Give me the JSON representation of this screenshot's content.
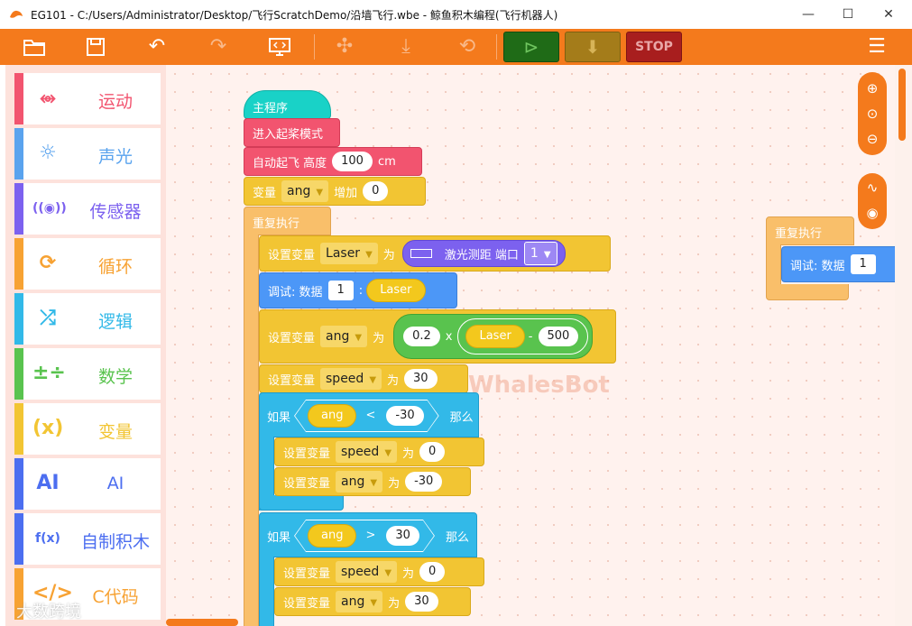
{
  "window": {
    "title": "EG101 - C:/Users/Administrator/Desktop/飞行ScratchDemo/沿墙飞行.wbe  - 鲸鱼积木编程(飞行机器人)",
    "controls": {
      "minimize": "—",
      "maximize": "☐",
      "close": "✕"
    }
  },
  "toolbar": {
    "stop_label": "STOP",
    "icons": [
      "folder-icon",
      "save-icon",
      "undo-icon",
      "redo-icon",
      "code-view-icon",
      "drone-icon",
      "download-icon",
      "reset-icon",
      "run-icon",
      "download-run-icon",
      "menu-icon"
    ]
  },
  "palette": [
    {
      "label": "运动",
      "icon": "⥈",
      "color": "#f2546f"
    },
    {
      "label": "声光",
      "icon": "☼",
      "color": "#5aa3ee"
    },
    {
      "label": "传感器",
      "icon": "((◉))",
      "color": "#7c61ef"
    },
    {
      "label": "循环",
      "icon": "⟳",
      "color": "#f7a233"
    },
    {
      "label": "逻辑",
      "icon": "⤮",
      "color": "#32b9e8"
    },
    {
      "label": "数学",
      "icon": "±÷",
      "color": "#59c34e"
    },
    {
      "label": "变量",
      "icon": "(x)",
      "color": "#f2c533"
    },
    {
      "label": "AI",
      "icon": "AI",
      "color": "#4c6ef0"
    },
    {
      "label": "自制积木",
      "icon": "f(x)",
      "color": "#4c6ef0"
    },
    {
      "label": "C代码",
      "icon": "</>",
      "color": "#f7a233"
    }
  ],
  "watermark": {
    "text": "WhalesBot",
    "overlay": "大数跨境"
  },
  "script": {
    "main_label": "主程序",
    "enter_takeoff": "进入起桨模式",
    "auto_takeoff": {
      "label": "自动起飞  高度",
      "value": "100",
      "unit": "cm"
    },
    "var_inc": {
      "label": "变量",
      "var": "ang",
      "op": "增加",
      "value": "0"
    },
    "repeat": "重复执行",
    "set_laser": {
      "label": "设置变量",
      "var": "Laser",
      "to": "为",
      "sensor": "激光测距  端口",
      "port": "1"
    },
    "debug": {
      "label": "调试:  数据",
      "value": "1",
      "sep": ":",
      "var": "Laser"
    },
    "set_ang": {
      "label": "设置变量",
      "var": "ang",
      "to": "为",
      "a": "0.2",
      "times": "x",
      "laser": "Laser",
      "minus": "-",
      "b": "500"
    },
    "set_speed": {
      "label": "设置变量",
      "var": "speed",
      "to": "为",
      "value": "30"
    },
    "if1": {
      "if": "如果",
      "var": "ang",
      "op": "<",
      "value": "-30",
      "then": "那么",
      "speed": {
        "label": "设置变量",
        "var": "speed",
        "to": "为",
        "value": "0"
      },
      "ang": {
        "label": "设置变量",
        "var": "ang",
        "to": "为",
        "value": "-30"
      }
    },
    "if2": {
      "if": "如果",
      "var": "ang",
      "op": ">",
      "value": "30",
      "then": "那么",
      "speed": {
        "label": "设置变量",
        "var": "speed",
        "to": "为",
        "value": "0"
      },
      "ang": {
        "label": "设置变量",
        "var": "ang",
        "to": "为",
        "value": "30"
      }
    }
  },
  "side_script": {
    "repeat": "重复执行",
    "debug": "调试:  数据",
    "value": "1"
  }
}
